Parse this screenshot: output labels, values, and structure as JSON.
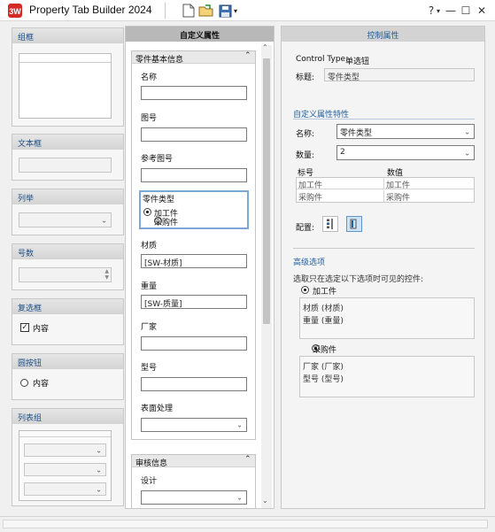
{
  "window": {
    "title": "Property Tab Builder 2024",
    "controls": {
      "help": "?",
      "help_dropdown": "▾",
      "minimize": "—",
      "maximize": "☐",
      "close": "✕"
    }
  },
  "toolbar": {
    "icons": [
      "new-file-icon",
      "open-folder-icon",
      "save-icon",
      "save-dropdown-icon"
    ]
  },
  "palette": {
    "groupbox": {
      "label": "组框"
    },
    "textbox": {
      "label": "文本框"
    },
    "list": {
      "label": "列举"
    },
    "number": {
      "label": "号数"
    },
    "checkbox": {
      "label": "复选框",
      "item": "内容"
    },
    "radio": {
      "label": "圆按钮",
      "item": "内容"
    },
    "listgroup": {
      "label": "列表组"
    }
  },
  "custom": {
    "header": "自定义属性",
    "part_group": {
      "title": "零件基本信息",
      "fields": {
        "name": {
          "label": "名称",
          "value": ""
        },
        "drawing": {
          "label": "图号",
          "value": ""
        },
        "ref_drawing": {
          "label": "参考图号",
          "value": ""
        },
        "part_type": {
          "label": "零件类型",
          "options": [
            "加工件",
            "采购件"
          ]
        },
        "material": {
          "label": "材质",
          "value": "[SW-材质]"
        },
        "weight": {
          "label": "重量",
          "value": "[SW-质量]"
        },
        "vendor": {
          "label": "厂家",
          "value": ""
        },
        "model": {
          "label": "型号",
          "value": ""
        },
        "surface": {
          "label": "表面处理",
          "value": ""
        }
      }
    },
    "review_group": {
      "title": "审核信息",
      "fields": {
        "design": {
          "label": "设计",
          "value": ""
        }
      }
    }
  },
  "control": {
    "header": "控制属性",
    "control_type_label": "Control Type:",
    "control_type_value": "单选钮",
    "caption_label": "标题:",
    "caption_value": "零件类型",
    "custom_section": "自定义属性特性",
    "name_label": "名称:",
    "name_value": "零件类型",
    "count_label": "数量:",
    "count_value": "2",
    "table_headers": [
      "标号",
      "数值"
    ],
    "table_rows": [
      [
        "加工件",
        "加工件"
      ],
      [
        "采购件",
        "采购件"
      ]
    ],
    "config_label": "配置:",
    "advanced_section": "高级选项",
    "advanced_desc": "选取只在选定以下选项时可见的控件:",
    "option1_label": "加工件",
    "option1_items": [
      "材质 (材质)",
      "重量 (重量)"
    ],
    "option2_label": "采购件",
    "option2_items": [
      "厂家 (厂家)",
      "型号 (型号)"
    ]
  },
  "colors": {
    "accent": "#1f5f9c",
    "logo_red": "#d42a25",
    "selection": "#7fa7d6"
  }
}
